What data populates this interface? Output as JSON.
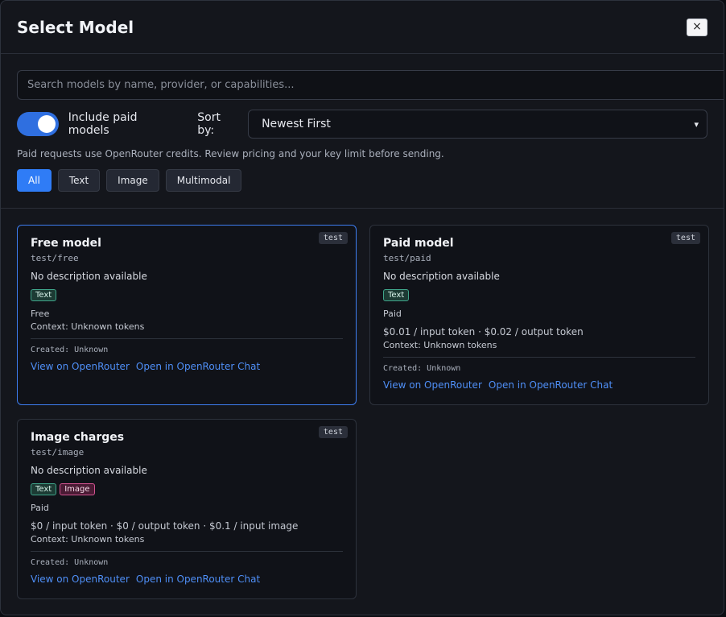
{
  "modal": {
    "title": "Select Model",
    "close_label": "×"
  },
  "search": {
    "placeholder": "Search models by name, provider, or capabilities...",
    "value": ""
  },
  "paid_toggle": {
    "label": "Include paid models",
    "on": true
  },
  "sort": {
    "label": "Sort by:",
    "selected": "Newest First"
  },
  "note": "Paid requests use OpenRouter credits. Review pricing and your key limit before sending.",
  "filters": [
    {
      "label": "All",
      "active": true
    },
    {
      "label": "Text",
      "active": false
    },
    {
      "label": "Image",
      "active": false
    },
    {
      "label": "Multimodal",
      "active": false
    }
  ],
  "cards": [
    {
      "name": "Free model",
      "id": "test/free",
      "badge": "test",
      "description": "No description available",
      "tags": [
        "Text"
      ],
      "price_type": "Free",
      "price_line": "",
      "context": "Context: Unknown tokens",
      "created": "Created: Unknown",
      "link_view": "View on OpenRouter",
      "link_chat": "Open in OpenRouter Chat"
    },
    {
      "name": "Paid model",
      "id": "test/paid",
      "badge": "test",
      "description": "No description available",
      "tags": [
        "Text"
      ],
      "price_type": "Paid",
      "price_line": "$0.01 / input token · $0.02 / output token",
      "context": "Context: Unknown tokens",
      "created": "Created: Unknown",
      "link_view": "View on OpenRouter",
      "link_chat": "Open in OpenRouter Chat"
    },
    {
      "name": "Image charges",
      "id": "test/image",
      "badge": "test",
      "description": "No description available",
      "tags": [
        "Text",
        "Image"
      ],
      "price_type": "Paid",
      "price_line": "$0 / input token · $0 / output token · $0.1 / input image",
      "context": "Context: Unknown tokens",
      "created": "Created: Unknown",
      "link_view": "View on OpenRouter",
      "link_chat": "Open in OpenRouter Chat"
    }
  ],
  "colors": {
    "accent": "#2f7cf6",
    "link": "#4f8ff7",
    "tag_text": "#3fa58a",
    "tag_image": "#d35391"
  }
}
